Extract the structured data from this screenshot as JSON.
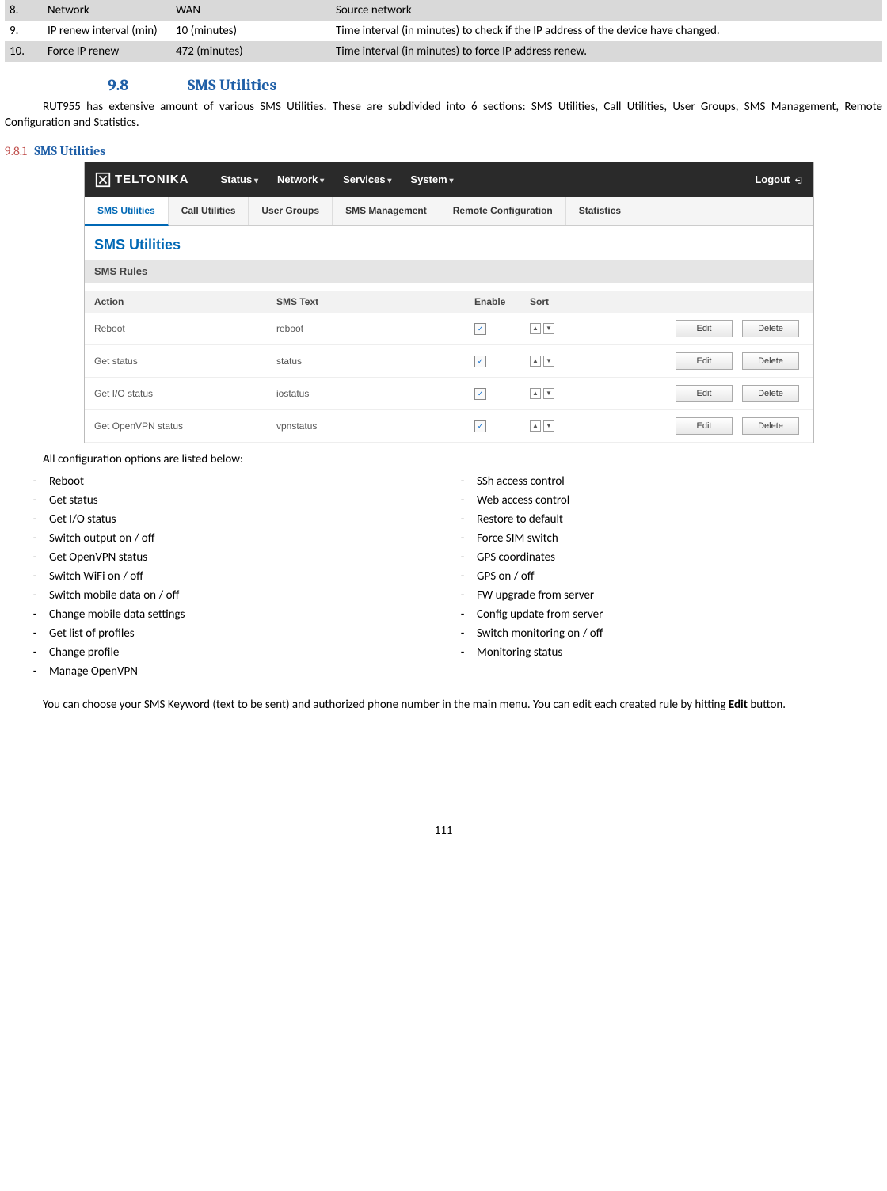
{
  "param_rows": [
    {
      "n": "8.",
      "name": "Network",
      "val": "WAN",
      "desc": "Source network",
      "grey": true
    },
    {
      "n": "9.",
      "name": "IP renew interval (min)",
      "val": "10 (minutes)",
      "desc": "Time interval (in minutes) to check if the IP address of the device have changed.",
      "grey": false
    },
    {
      "n": "10.",
      "name": "Force IP renew",
      "val": "472 (minutes)",
      "desc": "Time interval (in minutes) to force IP address renew.",
      "grey": true
    }
  ],
  "section": {
    "num": "9.8",
    "title": "SMS Utilities"
  },
  "intro": "RUT955 has extensive amount of various SMS Utilities. These are subdivided into 6 sections: SMS Utilities, Call Utilities, User Groups, SMS Management, Remote Configuration and Statistics.",
  "subsection": {
    "num": "9.8.1",
    "title": "SMS Utilities"
  },
  "screenshot": {
    "logo": "TELTONIKA",
    "nav": [
      "Status",
      "Network",
      "Services",
      "System"
    ],
    "logout": "Logout",
    "tabs": [
      "SMS Utilities",
      "Call Utilities",
      "User Groups",
      "SMS Management",
      "Remote Configuration",
      "Statistics"
    ],
    "active_tab": 0,
    "page_title": "SMS Utilities",
    "band": "SMS Rules",
    "headers": [
      "Action",
      "SMS Text",
      "Enable",
      "Sort"
    ],
    "rows": [
      {
        "action": "Reboot",
        "text": "reboot"
      },
      {
        "action": "Get status",
        "text": "status"
      },
      {
        "action": "Get I/O status",
        "text": "iostatus"
      },
      {
        "action": "Get OpenVPN status",
        "text": "vpnstatus"
      }
    ],
    "btn_edit": "Edit",
    "btn_delete": "Delete"
  },
  "after_ss": "All configuration options are listed below:",
  "col_a": [
    "Reboot",
    "Get status",
    "Get I/O status",
    "Switch output on / off",
    "Get OpenVPN status",
    "Switch WiFi on / off",
    "Switch mobile data on / off",
    "Change mobile data settings",
    "Get list of profiles",
    "Change profile",
    "Manage OpenVPN"
  ],
  "col_b": [
    "SSh access control",
    "Web access control",
    "Restore to default",
    "Force SIM switch",
    "GPS coordinates",
    "GPS on / off",
    "FW upgrade from server",
    "Config update from server",
    "Switch monitoring on / off",
    "Monitoring status"
  ],
  "closing": "You can choose your SMS Keyword (text to be sent) and authorized phone number in the main menu. You can edit each created rule by hitting ",
  "closing_bold": "Edit",
  "closing_end": " button.",
  "page_num": "111"
}
